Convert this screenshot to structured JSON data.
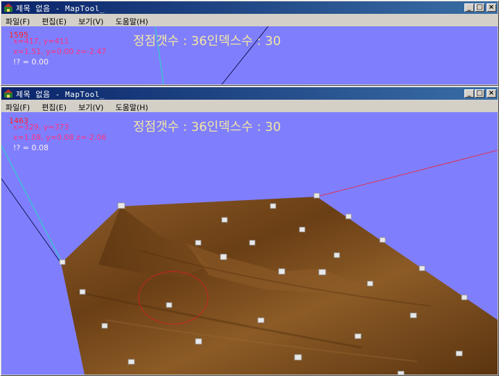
{
  "windows": [
    {
      "title": "제목 없음 - MapTool_",
      "menu": [
        "파일(F)",
        "편집(E)",
        "보기(V)",
        "도움말(H)"
      ],
      "hud": {
        "frame_counter": "1595",
        "mouse": "x=417, y=411",
        "world": "x=1.51, y=0.00 z=-2.47",
        "angle": "!? = 0.00",
        "summary": "정점갯수 : 36인덱스수 : 30"
      }
    },
    {
      "title": "제목 없음 - MapTool_",
      "menu": [
        "파일(F)",
        "편집(E)",
        "보기(V)",
        "도움말(H)"
      ],
      "hud": {
        "frame_counter": "1463",
        "mouse": "x=329, y=373",
        "world": "x=1.08, y=0.08 z=-2.06",
        "angle": "!? = 0.08",
        "summary": "정점갯수 : 36인덱스수 : 30"
      }
    }
  ],
  "buttons": {
    "minimize": "_",
    "maximize": "□",
    "close": "×"
  },
  "colors": {
    "viewport_bg": "#7f7ffd",
    "hud_red": "#ff2020",
    "hud_pink": "#ff3080",
    "hud_title": "#f3e6a0",
    "terrain_wood": "#7a4a1c",
    "title_bar": "#0a246a"
  }
}
